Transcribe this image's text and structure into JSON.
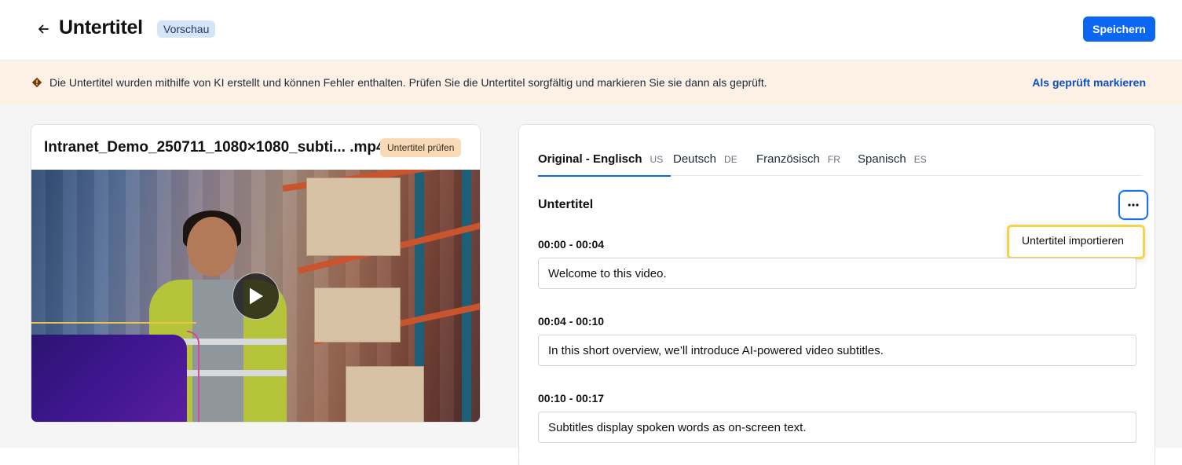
{
  "header": {
    "title": "Untertitel",
    "badge": "Vorschau",
    "save_label": "Speichern"
  },
  "banner": {
    "message": "Die Untertitel wurden mithilfe von KI erstellt und können Fehler enthalten. Prüfen Sie die Untertitel sorgfältig und markieren Sie sie dann als geprüft.",
    "action_label": "Als geprüft markieren"
  },
  "video": {
    "filename": "Intranet_Demo_250711_1080×1080_subti... .mp4",
    "status_badge": "Untertitel prüfen"
  },
  "panel": {
    "tabs": [
      {
        "label": "Original - Englisch",
        "code": "US",
        "active": true
      },
      {
        "label": "Deutsch",
        "code": "DE",
        "active": false
      },
      {
        "label": "Französisch",
        "code": "FR",
        "active": false
      },
      {
        "label": "Spanisch",
        "code": "ES",
        "active": false
      }
    ],
    "section_title": "Untertitel",
    "menu": {
      "items": [
        "Untertitel importieren"
      ]
    },
    "cues": [
      {
        "time": "00:00 - 00:04",
        "text": "Welcome to this video."
      },
      {
        "time": "00:04 - 00:10",
        "text": "In this short overview, we’ll introduce AI-powered video subtitles."
      },
      {
        "time": "00:10 - 00:17",
        "text": "Subtitles display spoken words as on-screen text."
      }
    ]
  },
  "colors": {
    "primary": "#0b67f2",
    "banner_bg": "#fdf0e4",
    "highlight": "#f2d548"
  }
}
